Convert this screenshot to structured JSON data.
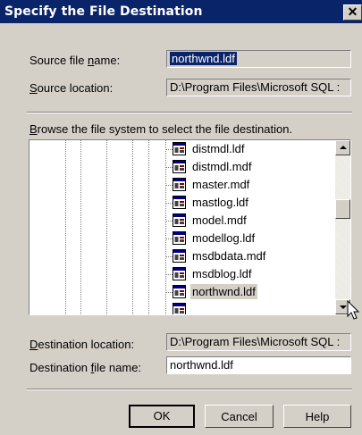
{
  "title": "Specify the File Destination",
  "close_glyph": "✕",
  "source": {
    "name_label": "Source file name:",
    "name_value": "northwnd.ldf",
    "location_label": "Source location:",
    "location_value": "D:\\Program Files\\Microsoft SQL :"
  },
  "browse_label": "Browse the file system to select the file destination.",
  "tree": {
    "items": [
      "distmdl.ldf",
      "distmdl.mdf",
      "master.mdf",
      "mastlog.ldf",
      "model.mdf",
      "modellog.ldf",
      "msdbdata.mdf",
      "msdblog.ldf",
      "northwnd.ldf"
    ],
    "selected": "northwnd.ldf",
    "file_icon": "sql-file-icon"
  },
  "destination": {
    "location_label": "Destination location:",
    "location_value": "D:\\Program Files\\Microsoft SQL :",
    "name_label": "Destination file name:",
    "name_value": "northwnd.ldf"
  },
  "buttons": {
    "ok": "OK",
    "cancel": "Cancel",
    "help": "Help"
  },
  "colors": {
    "titlebar": "#0a246a",
    "dialog": "#d4d0c8",
    "selection": "#0a246a"
  }
}
